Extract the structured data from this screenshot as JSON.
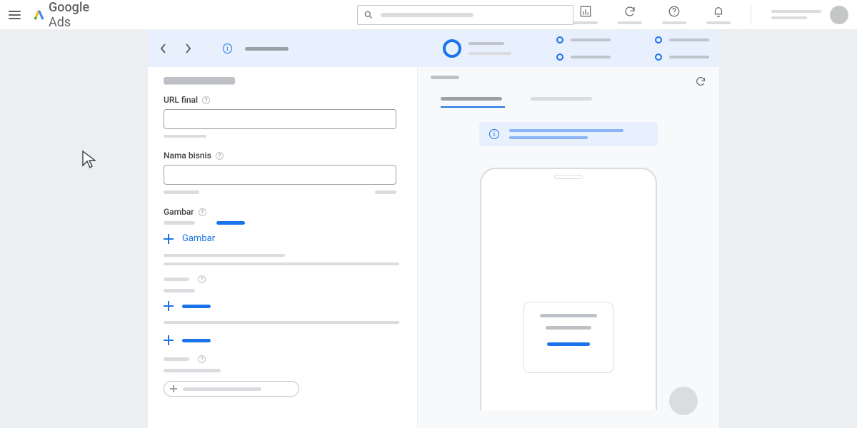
{
  "header": {
    "logo_primary": "Google",
    "logo_secondary": "Ads"
  },
  "form": {
    "url_final": {
      "label": "URL final",
      "value": ""
    },
    "business_name": {
      "label": "Nama bisnis",
      "value": ""
    },
    "gambar": {
      "label": "Gambar",
      "add_label": "Gambar"
    }
  }
}
